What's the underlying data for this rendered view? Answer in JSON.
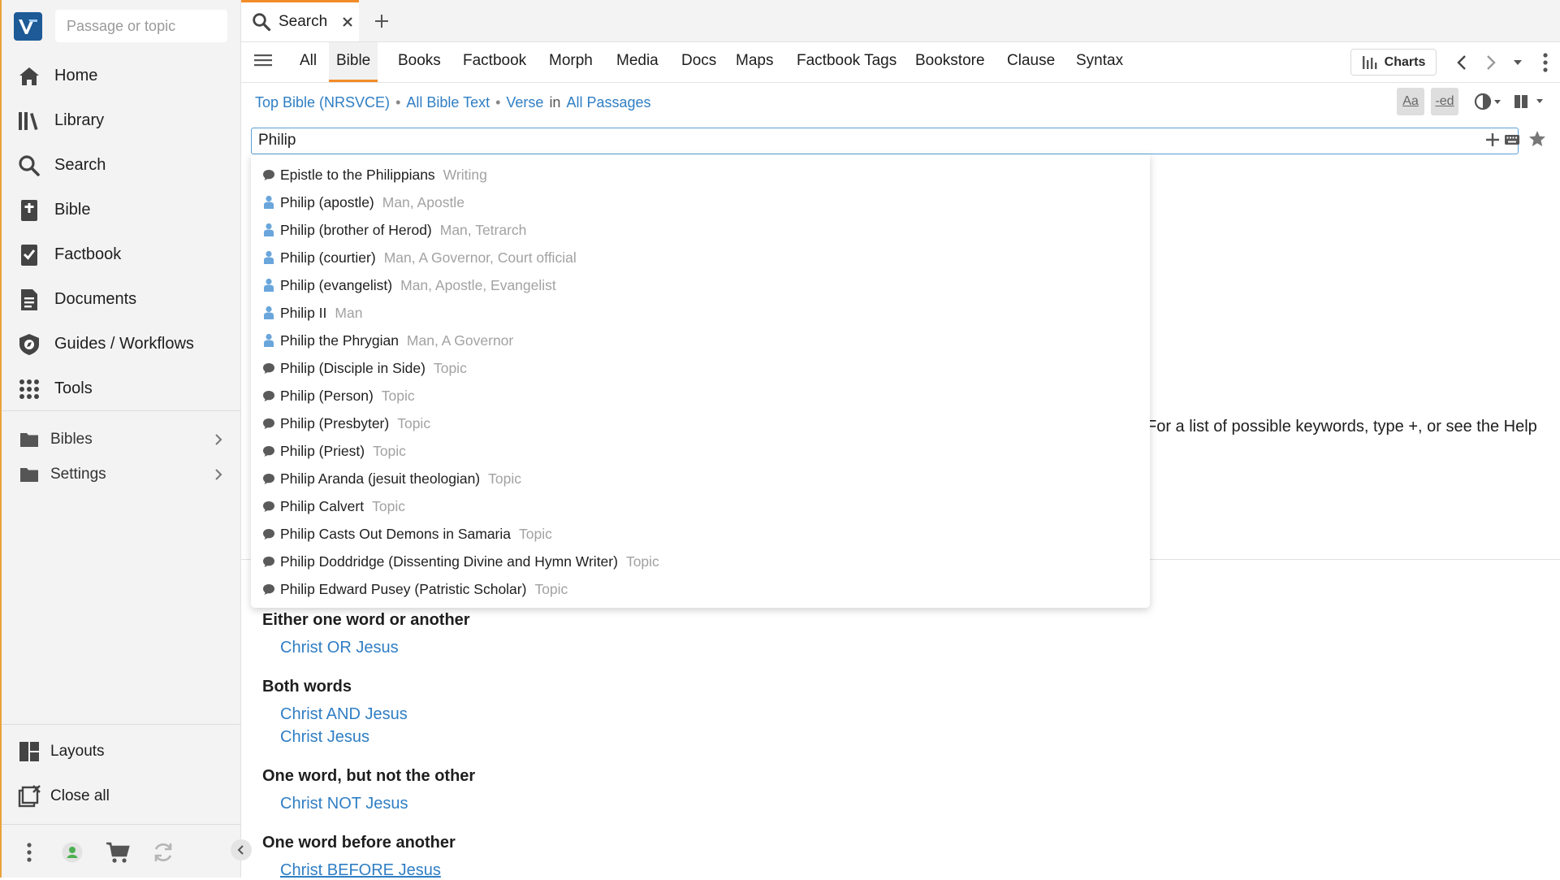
{
  "sidebar": {
    "passage_placeholder": "Passage or topic",
    "nav": [
      {
        "label": "Home",
        "icon": "home-icon"
      },
      {
        "label": "Library",
        "icon": "library-icon"
      },
      {
        "label": "Search",
        "icon": "search-icon"
      },
      {
        "label": "Bible",
        "icon": "bible-icon"
      },
      {
        "label": "Factbook",
        "icon": "factbook-icon"
      },
      {
        "label": "Documents",
        "icon": "documents-icon"
      },
      {
        "label": "Guides / Workflows",
        "icon": "guides-icon"
      },
      {
        "label": "Tools",
        "icon": "tools-grid-icon"
      }
    ],
    "folders": [
      {
        "label": "Bibles",
        "icon": "folder-icon"
      },
      {
        "label": "Settings",
        "icon": "folder-icon"
      }
    ],
    "bottom": {
      "layouts": "Layouts",
      "close_all": "Close all"
    },
    "status_color": "#4caf50"
  },
  "tab": {
    "title": "Search"
  },
  "search_tabs": [
    "All",
    "Bible",
    "Books",
    "Factbook",
    "Morph",
    "Media",
    "Docs",
    "Maps",
    "Factbook Tags",
    "Bookstore",
    "Clause",
    "Syntax"
  ],
  "active_search_tab": "Bible",
  "toolbar": {
    "charts_label": "Charts",
    "format_aa": "Aa",
    "format_ed": "-ed"
  },
  "breadcrumb": {
    "resource": "Top Bible (NRSVCE)",
    "scope": "All Bible Text",
    "unit": "Verse",
    "in_word": "in",
    "range": "All Passages"
  },
  "query": {
    "value": "Philip"
  },
  "help_text": "For a list of possible keywords, type +, or see the Help",
  "dropdown": {
    "items": [
      {
        "label": "Epistle to the Philippians",
        "type": "Writing",
        "icon": "speech-bubble-icon"
      },
      {
        "label": "Philip (apostle)",
        "type": "Man, Apostle",
        "icon": "person-icon"
      },
      {
        "label": "Philip (brother of Herod)",
        "type": "Man, Tetrarch",
        "icon": "person-icon"
      },
      {
        "label": "Philip (courtier)",
        "type": "Man, A Governor, Court official",
        "icon": "person-icon"
      },
      {
        "label": "Philip (evangelist)",
        "type": "Man, Apostle, Evangelist",
        "icon": "person-icon"
      },
      {
        "label": "Philip II",
        "type": "Man",
        "icon": "person-icon"
      },
      {
        "label": "Philip the Phrygian",
        "type": "Man, A Governor",
        "icon": "person-icon"
      },
      {
        "label": "Philip (Disciple in Side)",
        "type": "Topic",
        "icon": "speech-bubble-icon"
      },
      {
        "label": "Philip (Person)",
        "type": "Topic",
        "icon": "speech-bubble-icon"
      },
      {
        "label": "Philip (Presbyter)",
        "type": "Topic",
        "icon": "speech-bubble-icon"
      },
      {
        "label": "Philip (Priest)",
        "type": "Topic",
        "icon": "speech-bubble-icon"
      },
      {
        "label": "Philip Aranda (jesuit theologian)",
        "type": "Topic",
        "icon": "speech-bubble-icon"
      },
      {
        "label": "Philip Calvert",
        "type": "Topic",
        "icon": "speech-bubble-icon"
      },
      {
        "label": "Philip Casts Out Demons in Samaria",
        "type": "Topic",
        "icon": "speech-bubble-icon"
      },
      {
        "label": "Philip Doddridge (Dissenting Divine and Hymn Writer)",
        "type": "Topic",
        "icon": "speech-bubble-icon"
      },
      {
        "label": "Philip Edward Pusey (Patristic Scholar)",
        "type": "Topic",
        "icon": "speech-bubble-icon"
      }
    ]
  },
  "examples": [
    {
      "heading": "Either one word or another",
      "links": [
        "Christ OR Jesus"
      ]
    },
    {
      "heading": "Both words",
      "links": [
        "Christ AND Jesus",
        "Christ Jesus"
      ]
    },
    {
      "heading": "One word, but not the other",
      "links": [
        "Christ NOT Jesus"
      ]
    },
    {
      "heading": "One word before another",
      "links": [
        "Christ BEFORE Jesus"
      ]
    }
  ],
  "colors": {
    "accent": "#f28c28",
    "link": "#2f7ec4",
    "logo": "#1d5a96",
    "person_icon": "#6aa6dc",
    "topic_icon": "#5a5a5a"
  }
}
